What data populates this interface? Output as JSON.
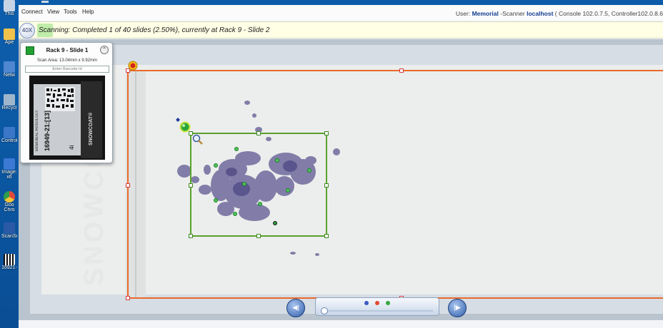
{
  "desktop": {
    "icons": [
      {
        "label": "This",
        "color": "#c7d4e6"
      },
      {
        "label": "Ape",
        "color": "#f0c24b"
      },
      {
        "label": "Netw",
        "color": "#4e86d0"
      },
      {
        "label": "Recycl",
        "color": "#9fb5cc"
      },
      {
        "label": "Control",
        "color": "#3a77c9"
      },
      {
        "label": "Image:",
        "color": "#3b79d4"
      },
      {
        "label": "x6",
        "color": ""
      },
      {
        "label": "Goo",
        "color": "#e04a3c"
      },
      {
        "label": "Chro",
        "color": ""
      },
      {
        "label": "ScanSc",
        "color": "#2a5aa6"
      },
      {
        "label": "16921-",
        "color": "#f2f2f2"
      }
    ]
  },
  "menu": {
    "items": [
      "Connect",
      "View",
      "Tools",
      "Help"
    ]
  },
  "userinfo": {
    "user_prefix": "User: ",
    "user": "Memorial",
    "role": " -Scanner ",
    "host": "localhost",
    "console": " ( Console 102.0.7.5, ",
    "controller": " Controller102.0.8.6"
  },
  "status": {
    "magnification": "40X",
    "message": "Scanning: Completed 1 of 40 slides (2.50%), currently at Rack 9 - Slide 2",
    "progress_percent": 2.5
  },
  "slide_card": {
    "title": "Rack 9 - Slide 1",
    "collapse_symbol": "⌃",
    "scan_area": "Scan Area: 13.04mm x 9.92mm",
    "barcode_placeholder": "Enter Barcode Id",
    "label_lines": [
      "MEMORIAL PATHOLOGY",
      "16949-21:[13]",
      "4i"
    ],
    "label_brand": "SNOWCOAT®"
  },
  "slide": {
    "watermark": "SNOWCO"
  },
  "navigation": {
    "prev_symbol": "◀|",
    "next_symbol": "|▶",
    "dots": [
      {
        "color": "#3b5cc4"
      },
      {
        "color": "#e04a2c"
      },
      {
        "color": "#34a83c"
      }
    ]
  },
  "colors": {
    "scan_area_border": "#ea6a2a",
    "roi_border": "#5aa12c",
    "tissue": "#6f6a9c",
    "accent": "#0b5ba8"
  }
}
